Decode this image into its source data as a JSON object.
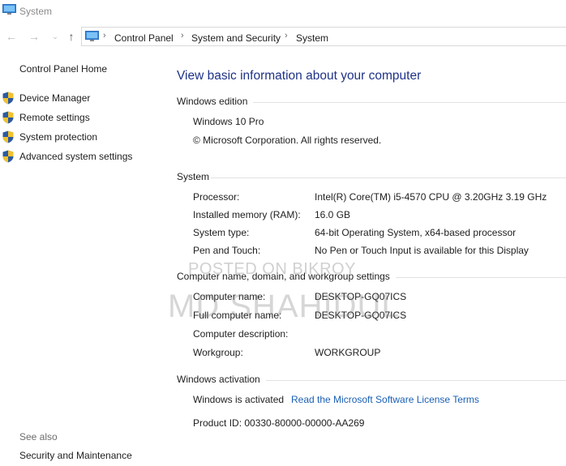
{
  "window": {
    "title": "System"
  },
  "nav": {
    "back": "←",
    "forward": "→",
    "recent": "⌄",
    "up": "↑",
    "breadcrumbs": [
      "Control Panel",
      "System and Security",
      "System"
    ],
    "separator": "›"
  },
  "sidebar": {
    "home": "Control Panel Home",
    "items": [
      {
        "label": "Device Manager",
        "icon": "shield-icon"
      },
      {
        "label": "Remote settings",
        "icon": "shield-icon"
      },
      {
        "label": "System protection",
        "icon": "shield-icon"
      },
      {
        "label": "Advanced system settings",
        "icon": "shield-icon"
      }
    ],
    "see_also": "See also",
    "see_also_link": "Security and Maintenance"
  },
  "main": {
    "title": "View basic information about your computer",
    "windows_edition": {
      "heading": "Windows edition",
      "name": "Windows 10 Pro",
      "copyright": "© Microsoft Corporation. All rights reserved."
    },
    "system": {
      "heading": "System",
      "rows": [
        {
          "label": "Processor:",
          "value": "Intel(R) Core(TM) i5-4570 CPU @ 3.20GHz   3.19 GHz"
        },
        {
          "label": "Installed memory (RAM):",
          "value": "16.0 GB"
        },
        {
          "label": "System type:",
          "value": "64-bit Operating System, x64-based processor"
        },
        {
          "label": "Pen and Touch:",
          "value": "No Pen or Touch Input is available for this Display"
        }
      ]
    },
    "computer_name": {
      "heading": "Computer name, domain, and workgroup settings",
      "rows": [
        {
          "label": "Computer name:",
          "value": "DESKTOP-GQ07ICS"
        },
        {
          "label": "Full computer name:",
          "value": "DESKTOP-GQ07ICS"
        },
        {
          "label": "Computer description:",
          "value": ""
        },
        {
          "label": "Workgroup:",
          "value": "WORKGROUP"
        }
      ]
    },
    "activation": {
      "heading": "Windows activation",
      "status": "Windows is activated",
      "license_link": "Read the Microsoft Software License Terms",
      "product_id": "Product ID:  00330-80000-00000-AA269"
    }
  },
  "watermark": {
    "line1": "POSTED ON BIKROY",
    "line2": "MD SHAHIDUL"
  },
  "colors": {
    "title_blue": "#1e3287",
    "link_blue": "#1a5fb4",
    "shield_blue": "#2c5aa0",
    "shield_yellow": "#f2c12e"
  }
}
